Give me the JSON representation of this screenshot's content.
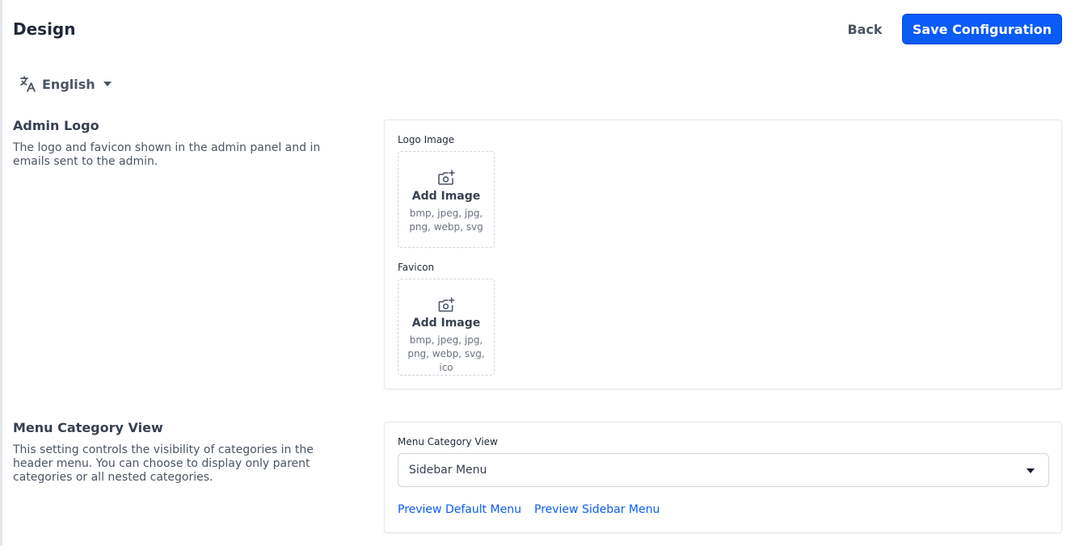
{
  "header": {
    "title": "Design",
    "back_label": "Back",
    "save_label": "Save Configuration"
  },
  "language": {
    "icon": "translate-icon",
    "selected": "English"
  },
  "admin_logo": {
    "title": "Admin Logo",
    "description": "The logo and favicon shown in the admin panel and in emails sent to the admin.",
    "logo_field": {
      "label": "Logo Image",
      "button_label": "Add Image",
      "formats": "bmp, jpeg, jpg, png, webp, svg",
      "icon": "camera-plus-icon"
    },
    "favicon_field": {
      "label": "Favicon",
      "button_label": "Add Image",
      "formats": "bmp, jpeg, jpg, png, webp, svg, ico",
      "icon": "camera-plus-icon"
    }
  },
  "menu_category": {
    "title": "Menu Category View",
    "description": "This setting controls the visibility of categories in the header menu. You can choose to display only parent categories or all nested categories.",
    "field_label": "Menu Category View",
    "selected_value": "Sidebar Menu",
    "preview_default": "Preview Default Menu",
    "preview_sidebar": "Preview Sidebar Menu"
  },
  "colors": {
    "primary": "#0b5cf6",
    "text_muted": "#4b5563",
    "border": "#e5e7eb"
  }
}
